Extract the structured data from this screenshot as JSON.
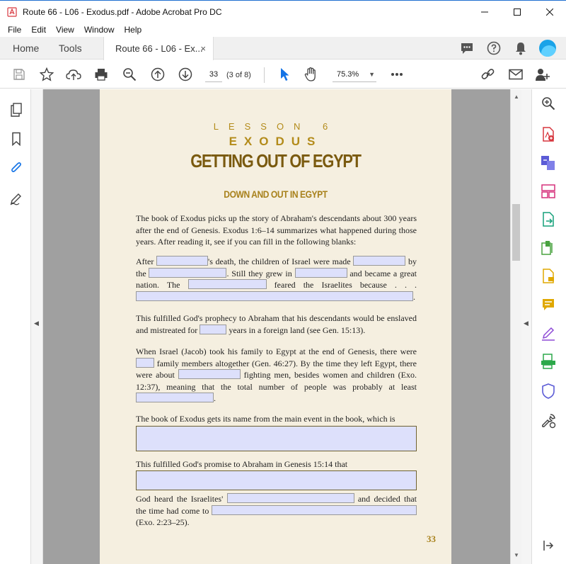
{
  "window": {
    "title": "Route 66 - L06 - Exodus.pdf - Adobe Acrobat Pro DC"
  },
  "menu": [
    "File",
    "Edit",
    "View",
    "Window",
    "Help"
  ],
  "tabs": {
    "home": "Home",
    "tools": "Tools",
    "document": "Route 66 - L06 - Ex...",
    "close": "×"
  },
  "toolbar": {
    "page_number": "33",
    "page_of": "(3 of 8)",
    "zoom": "75.3%"
  },
  "document": {
    "lesson_label": "LESSON 6",
    "lesson_book": "EXODUS",
    "title": "GETTING OUT OF EGYPT",
    "subtitle": "DOWN AND OUT IN EGYPT",
    "intro": "The book of Exodus picks up the story of Abraham's descendants about 300 years after the end of Genesis. Exodus 1:6–14 summarizes what happened during those years. After reading it, see if you can fill in the following blanks:",
    "p2": {
      "a": "After",
      "b": "'s death, the children of Israel were made",
      "c": "by the",
      "d": ". Still they grew in",
      "e": "and became a great nation. The",
      "f": "feared the Israelites because . . .",
      "g": "."
    },
    "p3": {
      "a": "This fulfilled God's prophecy to Abraham that his descendants would be enslaved and mistreated for",
      "b": "years in a foreign land (see Gen. 15:13)."
    },
    "p4": {
      "a": "When Israel (Jacob) took his family to Egypt at the end of Genesis, there were",
      "b": "family members altogether (Gen. 46:27). By the time they left Egypt, there were about",
      "c": "fighting men, besides women and children (Exo. 12:37), meaning that the total number of people was probably at least",
      "d": "."
    },
    "p5": "The book of Exodus gets its name from the main event in the book, which is",
    "p6": "This fulfilled God's promise to Abraham in Genesis 15:14 that",
    "p7": {
      "a": "God heard the Israelites'",
      "b": "and decided that the time had come to",
      "c": "(Exo. 2:23–25)."
    },
    "page_number": "33"
  },
  "colors": {
    "accent_gold": "#b38b1a",
    "title_brown": "#7a5a0f",
    "page_bg": "#f5efe0",
    "field_fill": "#dde0fb",
    "acrobat_red": "#d7373f"
  }
}
